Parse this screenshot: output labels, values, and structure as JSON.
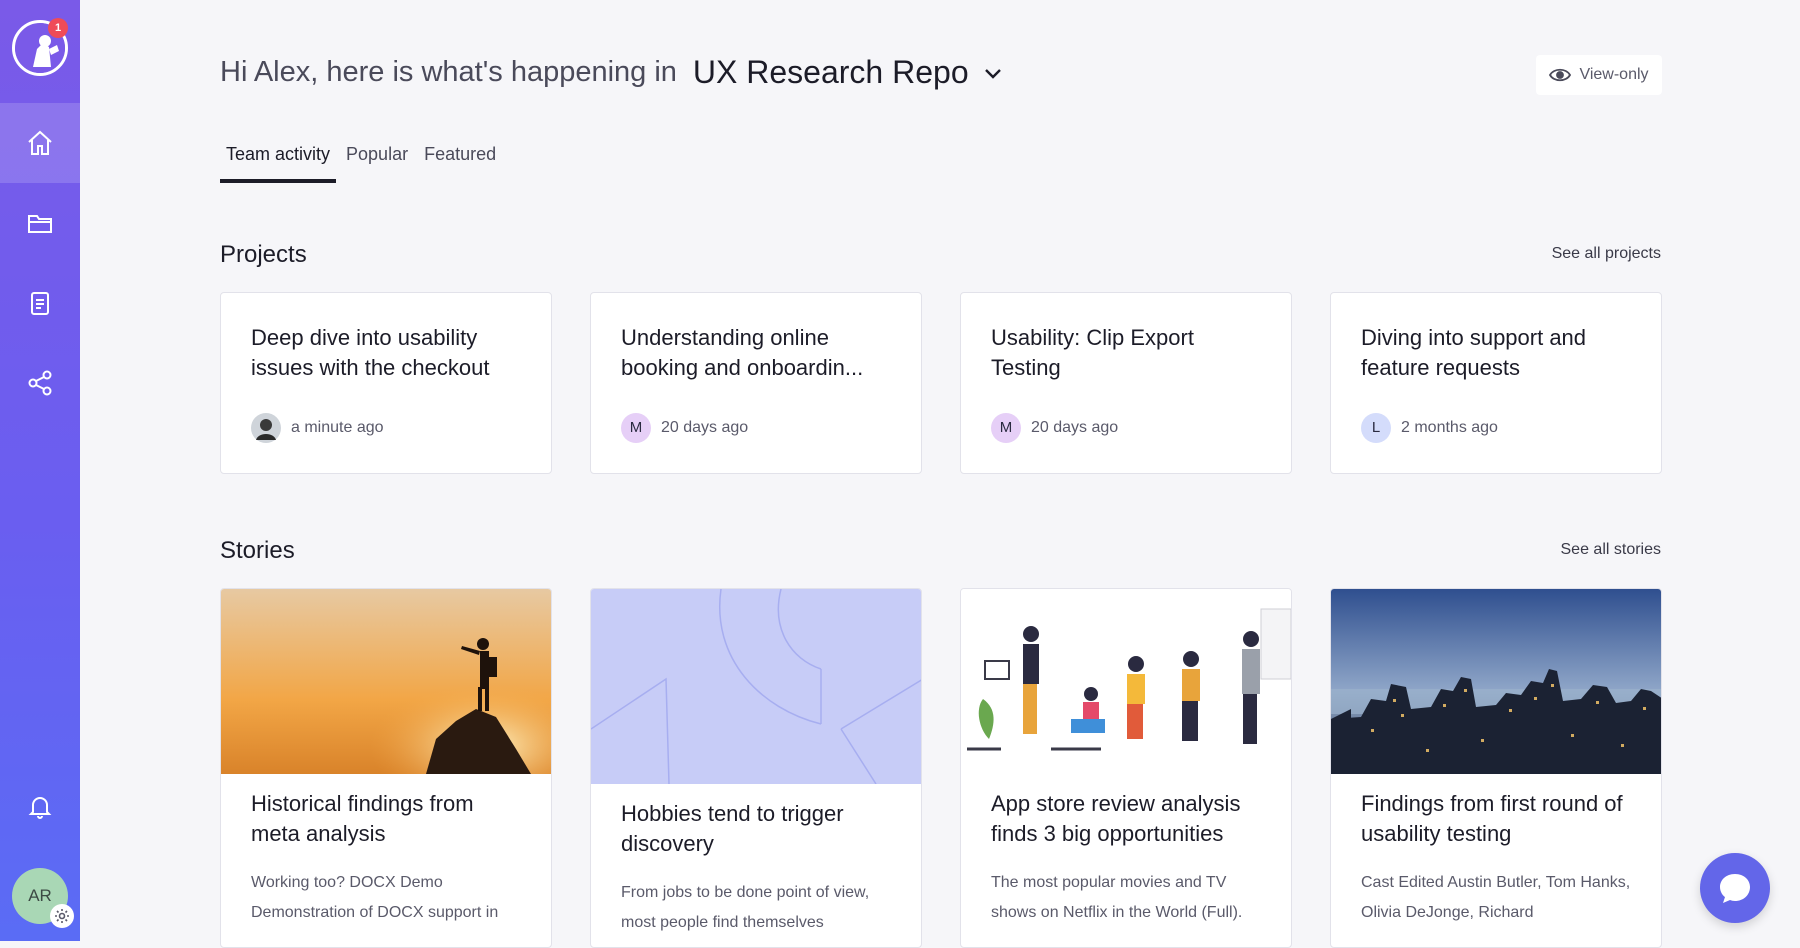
{
  "sidebar": {
    "logo_badge_count": "1",
    "nav": [
      {
        "name": "home",
        "icon": "home-icon",
        "active": true
      },
      {
        "name": "projects",
        "icon": "folder-icon"
      },
      {
        "name": "notes",
        "icon": "document-icon"
      },
      {
        "name": "share",
        "icon": "share-icon"
      }
    ],
    "notifications_icon": "bell-icon",
    "user_initials": "AR"
  },
  "header": {
    "greeting_prefix": "Hi Alex, here is what's happening in",
    "workspace": "UX Research Repo",
    "view_only_label": "View-only"
  },
  "tabs": [
    {
      "label": "Team activity",
      "active": true
    },
    {
      "label": "Popular"
    },
    {
      "label": "Featured"
    }
  ],
  "projects": {
    "title": "Projects",
    "see_all": "See all projects",
    "items": [
      {
        "title": "Deep dive into usability issues with the checkout",
        "avatar": "",
        "time": "a minute ago"
      },
      {
        "title": "Understanding online booking and onboardin...",
        "avatar": "M",
        "time": "20 days ago"
      },
      {
        "title": "Usability: Clip Export Testing",
        "avatar": "M",
        "time": "20 days ago"
      },
      {
        "title": "Diving into support and feature requests",
        "avatar": "L",
        "time": "2 months ago"
      }
    ]
  },
  "stories": {
    "title": "Stories",
    "see_all": "See all stories",
    "items": [
      {
        "title": "Historical findings from meta analysis",
        "desc": "Working too? DOCX Demo Demonstration of DOCX support in"
      },
      {
        "title": "Hobbies tend to trigger discovery",
        "desc": "From jobs to be done point of view, most people find themselves"
      },
      {
        "title": "App store review analysis finds 3 big opportunities",
        "desc": "The most popular movies and TV shows on Netflix in the World (Full)."
      },
      {
        "title": "Findings from first round of usability testing",
        "desc": "Cast Edited Austin Butler, Tom Hanks, Olivia DeJonge, Richard"
      }
    ]
  },
  "colors": {
    "sidebar_top": "#7a5ae8",
    "sidebar_bottom": "#5a6cf5",
    "accent": "#6366e9",
    "avatar_m": "#e6cff7",
    "avatar_l": "#d4dcfb"
  }
}
